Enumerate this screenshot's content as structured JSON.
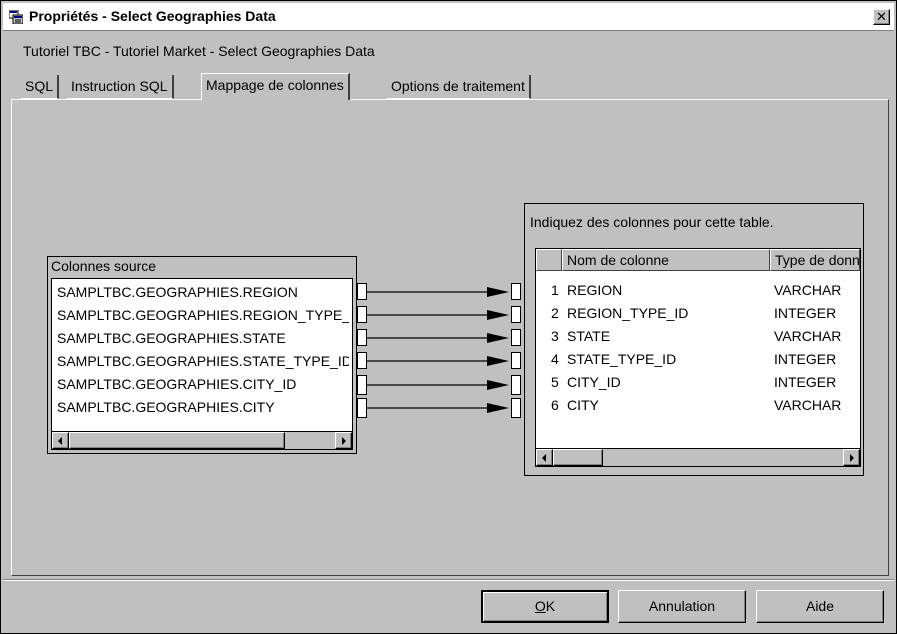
{
  "window": {
    "title": "Propriétés - Select Geographies Data",
    "close_label": "✕"
  },
  "breadcrumb": "Tutoriel TBC - Tutoriel Market - Select Geographies Data",
  "tabs": [
    {
      "label": "SQL",
      "active": false
    },
    {
      "label": "Instruction SQL",
      "active": false
    },
    {
      "label": "Mappage de colonnes",
      "active": true
    },
    {
      "label": "Options de traitement",
      "active": false
    }
  ],
  "source": {
    "label": "Colonnes source",
    "columns": [
      "SAMPLTBC.GEOGRAPHIES.REGION",
      "SAMPLTBC.GEOGRAPHIES.REGION_TYPE_ID",
      "SAMPLTBC.GEOGRAPHIES.STATE",
      "SAMPLTBC.GEOGRAPHIES.STATE_TYPE_ID",
      "SAMPLTBC.GEOGRAPHIES.CITY_ID",
      "SAMPLTBC.GEOGRAPHIES.CITY"
    ]
  },
  "target": {
    "label": "Indiquez des colonnes pour cette table.",
    "headers": {
      "name": "Nom de colonne",
      "type": "Type de données"
    },
    "rows": [
      {
        "num": "1",
        "name": "REGION",
        "type": "VARCHAR"
      },
      {
        "num": "2",
        "name": "REGION_TYPE_ID",
        "type": "INTEGER"
      },
      {
        "num": "3",
        "name": "STATE",
        "type": "VARCHAR"
      },
      {
        "num": "4",
        "name": "STATE_TYPE_ID",
        "type": "INTEGER"
      },
      {
        "num": "5",
        "name": "CITY_ID",
        "type": "INTEGER"
      },
      {
        "num": "6",
        "name": "CITY",
        "type": "VARCHAR"
      }
    ]
  },
  "buttons": {
    "ok_mnemonic": "O",
    "ok_rest": "K",
    "cancel": "Annulation",
    "help": "Aide"
  }
}
